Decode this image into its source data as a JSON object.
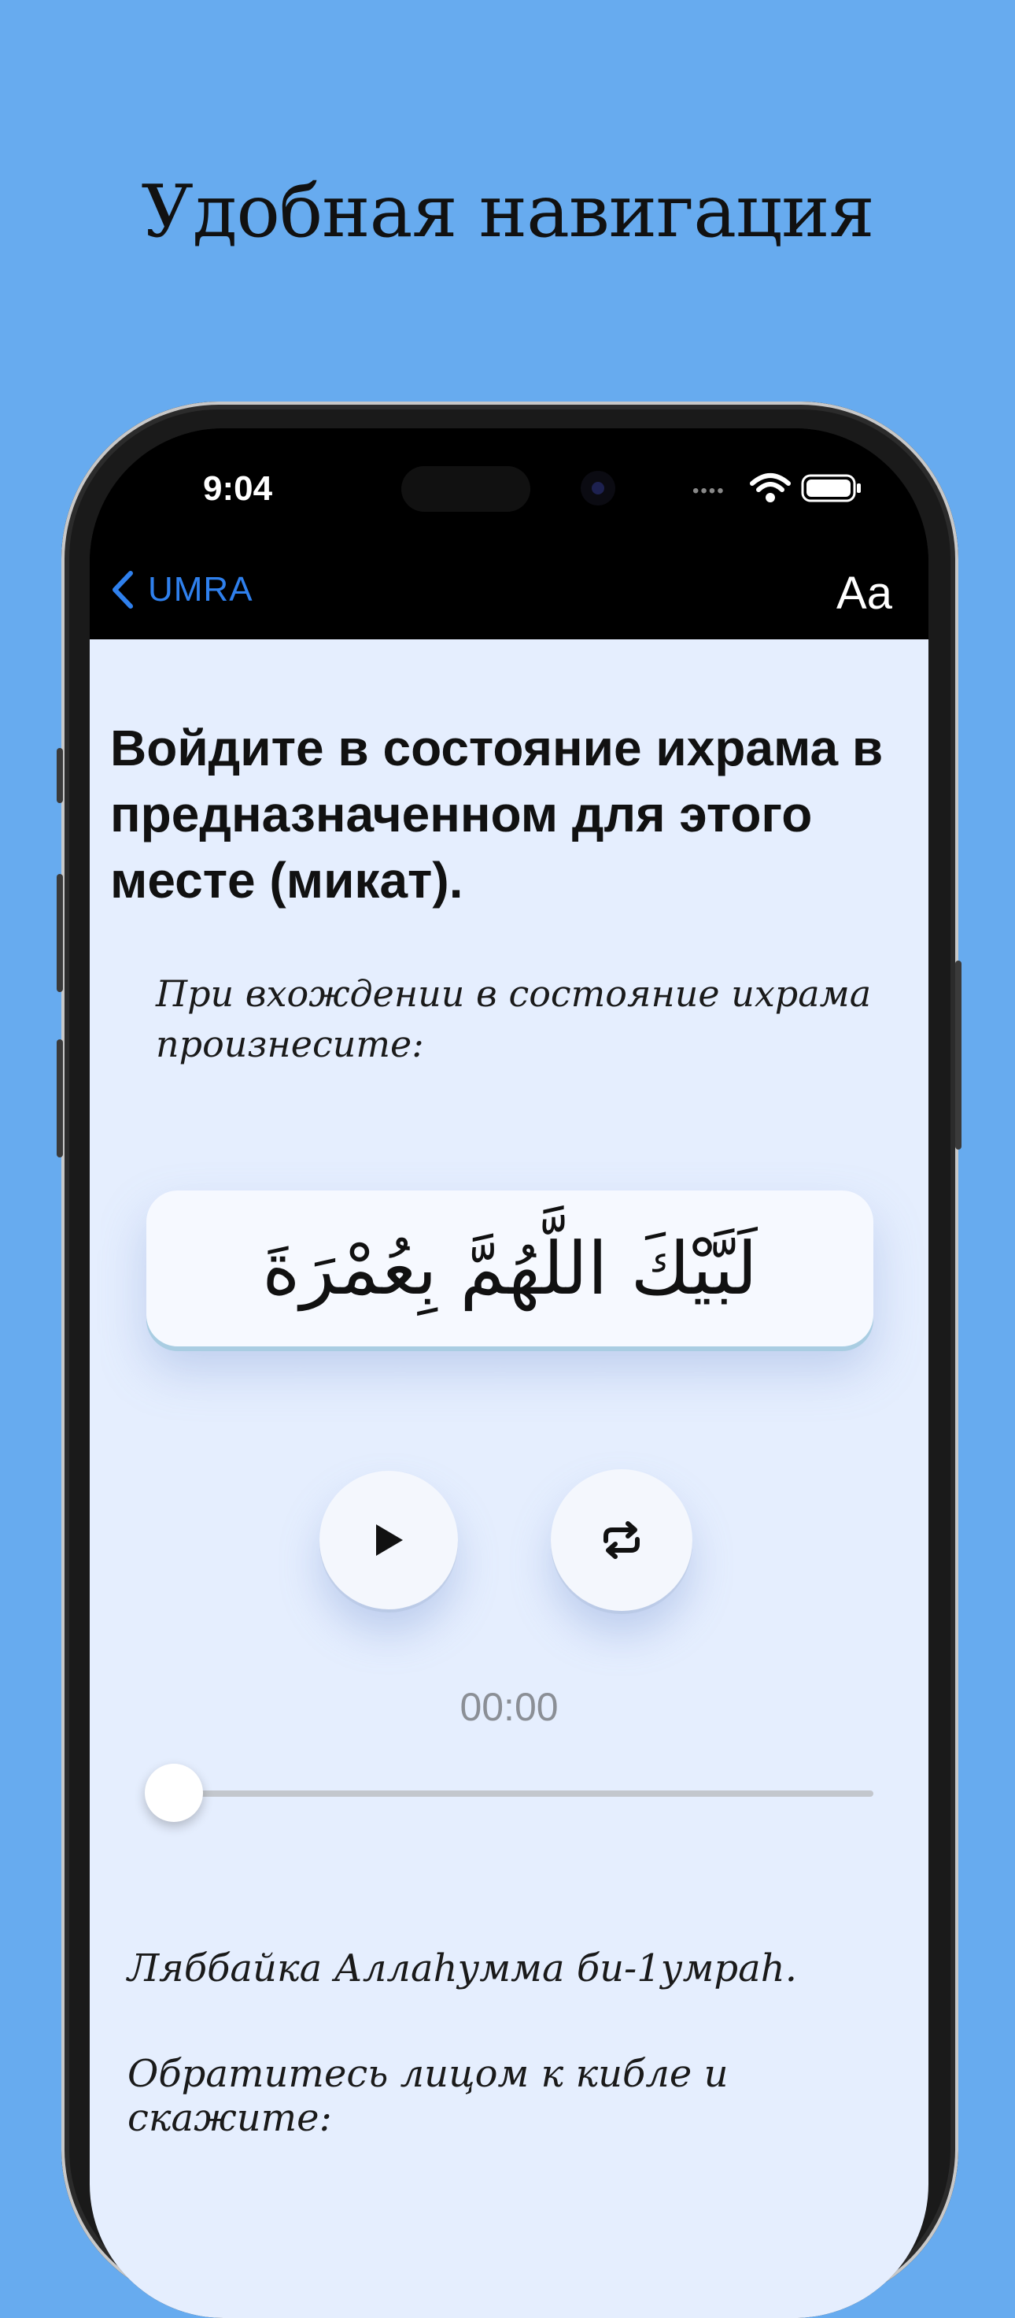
{
  "headline": "Удобная навигация",
  "status_bar": {
    "time": "9:04"
  },
  "nav": {
    "back_label": "UMRA",
    "font_button": "Aa",
    "back_icon": "chevron-left-icon"
  },
  "step": {
    "title": "Войдите в состояние ихрама в предназначенном для этого месте (микат).",
    "intro": "При вхождении в состояние ихрама произнесите:",
    "arabic": "لَبَّيْكَ اللَّهُمَّ بِعُمْرَةَ",
    "transliteration": "Ляббайка Аллаһумма би-1умраһ.",
    "instruction": "Обратитесь лицом к кибле и скажите:"
  },
  "audio": {
    "time": "00:00",
    "progress": 0,
    "play_icon": "play-icon",
    "repeat_icon": "repeat-icon"
  },
  "colors": {
    "background": "#67abef",
    "accent": "#2f80ed",
    "content_bg": "#e5eefe"
  }
}
